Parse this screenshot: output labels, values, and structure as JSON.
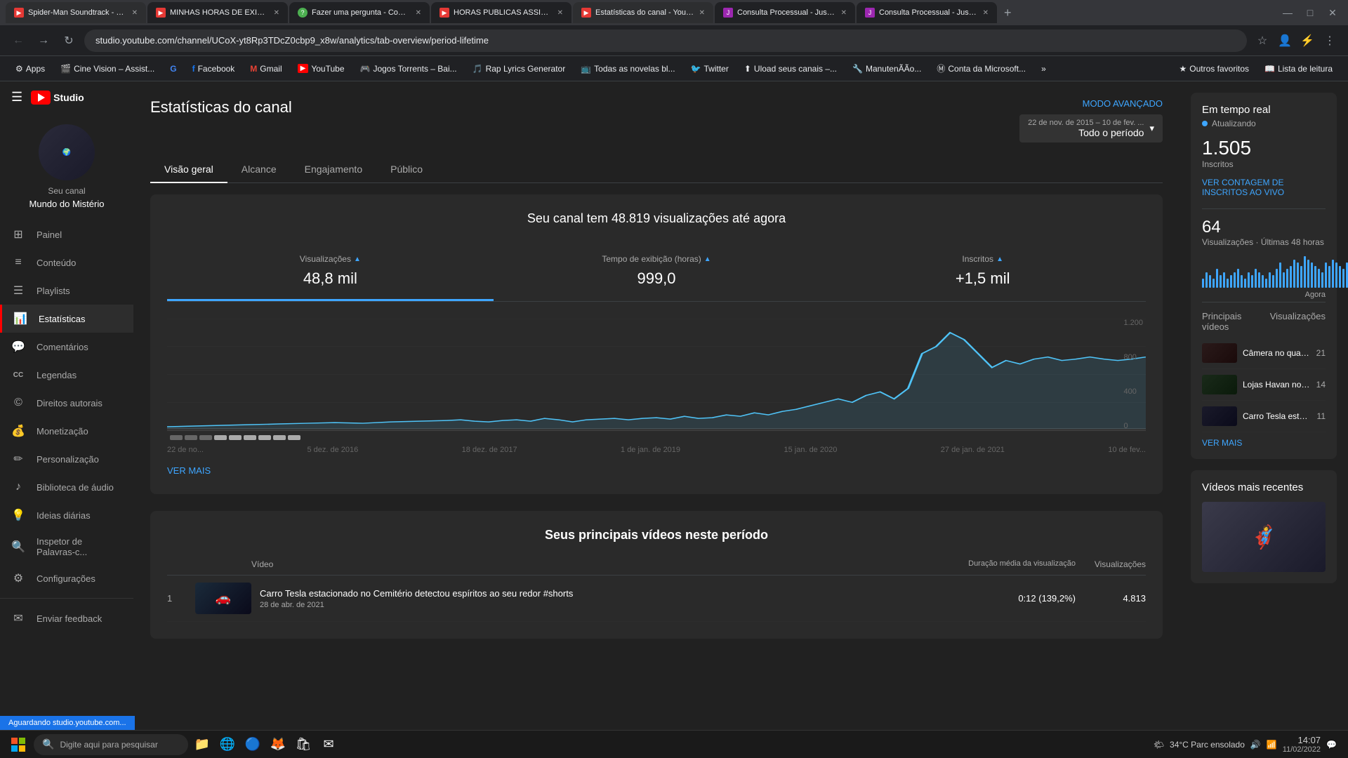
{
  "browser": {
    "tabs": [
      {
        "id": 1,
        "title": "Spider-Man Soundtrack - Resp...",
        "active": false,
        "color": "#e53935"
      },
      {
        "id": 2,
        "title": "MINHAS HORAS DE EXIBIÇÃO...",
        "active": false,
        "color": "#e53935"
      },
      {
        "id": 3,
        "title": "Fazer uma pergunta - Comuni...",
        "active": false,
        "color": "#4caf50"
      },
      {
        "id": 4,
        "title": "HORAS PUBLICAS ASSISTIDAS f...",
        "active": false,
        "color": "#e53935"
      },
      {
        "id": 5,
        "title": "Estatísticas do canal - YouTube...",
        "active": true,
        "color": "#e53935"
      },
      {
        "id": 6,
        "title": "Consulta Processual - Justiça F...",
        "active": false,
        "color": "#9c27b0"
      },
      {
        "id": 7,
        "title": "Consulta Processual - Justiça F...",
        "active": false,
        "color": "#9c27b0"
      }
    ],
    "address": "studio.youtube.com/channel/UCoX-yt8Rp3TDcZ0cbp9_x8w/analytics/tab-overview/period-lifetime",
    "bookmarks": [
      {
        "label": "Apps",
        "icon": "⚙"
      },
      {
        "label": "Cine Vision – Assist...",
        "icon": "🎬"
      },
      {
        "label": "Google",
        "icon": "G"
      },
      {
        "label": "Facebook",
        "icon": "f"
      },
      {
        "label": "Gmail",
        "icon": "M"
      },
      {
        "label": "YouTube",
        "icon": "▶"
      },
      {
        "label": "Jogos Torrents – Bai...",
        "icon": "🎮"
      },
      {
        "label": "Rap Lyrics Generator",
        "icon": "🎵"
      },
      {
        "label": "Todas as novelas bl...",
        "icon": "📺"
      },
      {
        "label": "Twitter",
        "icon": "🐦"
      },
      {
        "label": "Uload seus canais –...",
        "icon": "⬆"
      },
      {
        "label": "ManutenÃÃo...",
        "icon": "🔧"
      },
      {
        "label": "Conta da Microsoft...",
        "icon": "Ⓜ"
      },
      {
        "label": "»",
        "icon": ""
      },
      {
        "label": "Outros favoritos",
        "icon": "★"
      },
      {
        "label": "Lista de leitura",
        "icon": "📖"
      }
    ]
  },
  "sidebar": {
    "logo_text": "Studio",
    "channel_label": "Seu canal",
    "channel_name": "Mundo do Mistério",
    "nav_items": [
      {
        "id": "painel",
        "label": "Painel",
        "icon": "⊞",
        "active": false
      },
      {
        "id": "conteudo",
        "label": "Conteúdo",
        "icon": "≡",
        "active": false
      },
      {
        "id": "playlists",
        "label": "Playlists",
        "icon": "☰",
        "active": false
      },
      {
        "id": "estatisticas",
        "label": "Estatísticas",
        "icon": "📊",
        "active": true
      },
      {
        "id": "comentarios",
        "label": "Comentários",
        "icon": "💬",
        "active": false
      },
      {
        "id": "legendas",
        "label": "Legendas",
        "icon": "CC",
        "active": false
      },
      {
        "id": "direitos",
        "label": "Direitos autorais",
        "icon": "$",
        "active": false
      },
      {
        "id": "monetizacao",
        "label": "Monetização",
        "icon": "$",
        "active": false
      },
      {
        "id": "personalizacao",
        "label": "Personalização",
        "icon": "✏",
        "active": false
      },
      {
        "id": "biblioteca",
        "label": "Biblioteca de áudio",
        "icon": "♪",
        "active": false
      },
      {
        "id": "ideias",
        "label": "Ideias diárias",
        "icon": "💡",
        "active": false
      },
      {
        "id": "inspetor",
        "label": "Inspetor de Palavras-c...",
        "icon": "🔍",
        "active": false
      },
      {
        "id": "configuracoes",
        "label": "Configurações",
        "icon": "⚙",
        "active": false
      },
      {
        "id": "feedback",
        "label": "Enviar feedback",
        "icon": "✉",
        "active": false
      }
    ]
  },
  "main": {
    "page_title": "Estatísticas do canal",
    "advanced_mode_label": "MODO AVANÇADO",
    "date_range_small": "22 de nov. de 2015 – 10 de fev. ...",
    "date_range_large": "Todo o período",
    "tabs": [
      {
        "label": "Visão geral",
        "active": true
      },
      {
        "label": "Alcance",
        "active": false
      },
      {
        "label": "Engajamento",
        "active": false
      },
      {
        "label": "Público",
        "active": false
      }
    ],
    "chart_headline": "Seu canal tem 48.819 visualizações até agora",
    "metrics": [
      {
        "label": "Visualizações",
        "value": "48,8 mil",
        "active": true
      },
      {
        "label": "Tempo de exibição (horas)",
        "value": "999,0",
        "active": false
      },
      {
        "label": "Inscritos",
        "value": "+1,5 mil",
        "active": false
      }
    ],
    "chart_y_labels": [
      "1.200",
      "800",
      "400",
      "0"
    ],
    "chart_x_labels": [
      "22 de no...",
      "5 dez. de 2016",
      "18 dez. de 2017",
      "1 de jan. de 2019",
      "15 jan. de 2020",
      "27 de jan. de 2021",
      "10 de fev..."
    ],
    "see_more_label": "VER MAIS",
    "top_videos_title": "Seus principais vídeos neste período",
    "table_headers": {
      "video": "Vídeo",
      "duration": "Duração média da visualização",
      "views": "Visualizações"
    },
    "top_videos": [
      {
        "num": "1",
        "title": "Carro Tesla estacionado no Cemitério detectou espíritos ao seu redor #shorts",
        "date": "28 de abr. de 2021",
        "duration": "0:12  (139,2%)",
        "views": "4.813"
      }
    ]
  },
  "right_panel": {
    "realtime_title": "Em tempo real",
    "realtime_status": "Atualizando",
    "subscriber_count": "1.505",
    "subscriber_label": "Inscritos",
    "live_count_link": "VER CONTAGEM DE INSCRITOS AO VIVO",
    "views_count": "64",
    "views_label": "Visualizações · Últimas 48 horas",
    "now_label": "Agora",
    "top_videos_label": "Principais vídeos",
    "views_header": "Visualizações",
    "top_videos": [
      {
        "title": "Câmera no quarto da crianç...",
        "views": "21"
      },
      {
        "title": "Lojas Havan no Minecraft",
        "views": "14"
      },
      {
        "title": "Carro Tesla estacionado no ...",
        "views": "11"
      }
    ],
    "see_more_label": "VER MAIS",
    "recent_title": "Vídeos mais recentes",
    "mini_bars": [
      3,
      5,
      4,
      3,
      6,
      4,
      5,
      3,
      4,
      5,
      6,
      4,
      3,
      5,
      4,
      6,
      5,
      4,
      3,
      5,
      4,
      6,
      8,
      5,
      6,
      7,
      9,
      8,
      7,
      10,
      9,
      8,
      7,
      6,
      5,
      8,
      7,
      9,
      8,
      7,
      6,
      8,
      10,
      9,
      8,
      7,
      9,
      10
    ]
  },
  "taskbar": {
    "search_placeholder": "Digite aqui para pesquisar",
    "weather": "34°C  Parc ensolado",
    "time": "14:07",
    "date": "11/02/2022"
  },
  "status_bar": {
    "text": "Aguardando studio.youtube.com..."
  }
}
